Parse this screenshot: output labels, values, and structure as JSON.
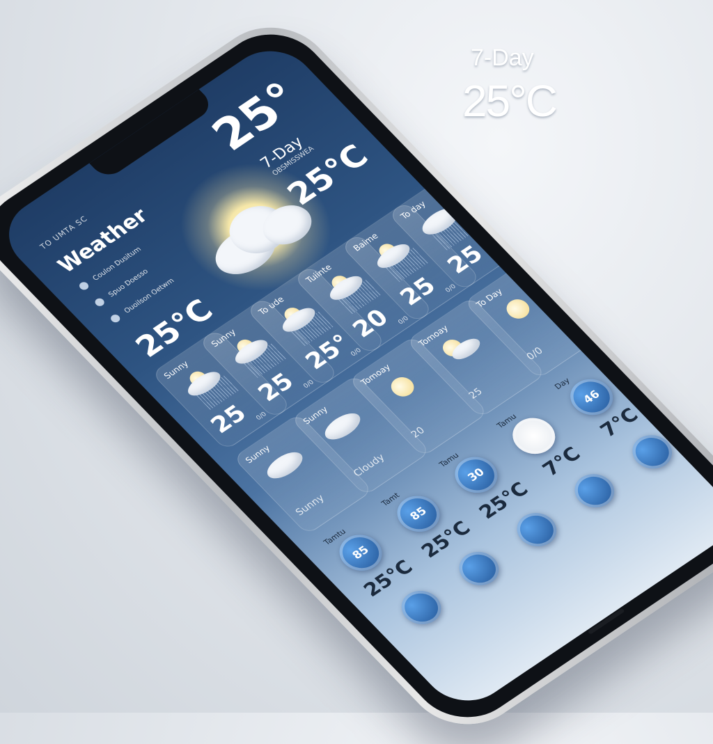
{
  "float": {
    "label": "7-Day",
    "temp": "25°C"
  },
  "header": {
    "caption": "TO UMTA SC",
    "title": "Weather",
    "big_temp": "25°",
    "days_label": "7-Day",
    "days_sub": "OBSMISSWEA",
    "main_temp": "25°C"
  },
  "sidebar": {
    "rows": [
      {
        "label": "Coulon Dusitum",
        "icon": "raindrop-icon"
      },
      {
        "label": "Spuo Doesso",
        "icon": "raindrop-icon"
      },
      {
        "label": "Ouoilson Oetwm",
        "icon": "raindrop-icon"
      }
    ],
    "temp": "25°C"
  },
  "forecast": {
    "row1": [
      {
        "label": "Sunny",
        "temp": "25",
        "unit": "0/0",
        "icon": "cloud-sun-rain-icon"
      },
      {
        "label": "Sunny",
        "temp": "25",
        "unit": "0/0",
        "icon": "cloud-sun-rain-icon"
      },
      {
        "label": "To ude",
        "temp": "25°",
        "unit": "0/0",
        "icon": "cloud-sun-rain-icon"
      },
      {
        "label": "Tuiinte",
        "temp": "20",
        "unit": "0/0",
        "icon": "cloud-sun-rain-icon"
      },
      {
        "label": "Baime",
        "temp": "25",
        "unit": "0/0",
        "icon": "cloud-sun-rain-icon"
      },
      {
        "label": "To day",
        "temp": "25",
        "unit": "0/0",
        "icon": "cloud-rain-icon"
      }
    ],
    "row2": [
      {
        "label": "Sunny",
        "caption": "Sunny",
        "icon": "cloud-rain-icon"
      },
      {
        "label": "Sunny",
        "caption": "Cloudy",
        "icon": "cloud-rain-icon"
      },
      {
        "label": "Tomoay",
        "caption": "20",
        "icon": "sun-icon"
      },
      {
        "label": "Tomoay",
        "caption": "25",
        "icon": "sun-cloud-icon"
      },
      {
        "label": "To Day",
        "caption": "0/0",
        "icon": "sun-icon"
      }
    ],
    "row3": [
      {
        "label": "Tamtu",
        "value": "85",
        "temp": "25°C"
      },
      {
        "label": "Tamt",
        "value": "85",
        "temp": "25°C"
      },
      {
        "label": "Tamu",
        "value": "30",
        "temp": "25°C"
      },
      {
        "label": "Tamu",
        "value": "",
        "temp": "7°C"
      },
      {
        "label": "Day",
        "value": "46",
        "temp": "7°C"
      }
    ]
  },
  "colors": {
    "screen_top": "#1f3d66",
    "screen_bottom": "#dfe9f3",
    "accent": "#1e4f8f"
  }
}
